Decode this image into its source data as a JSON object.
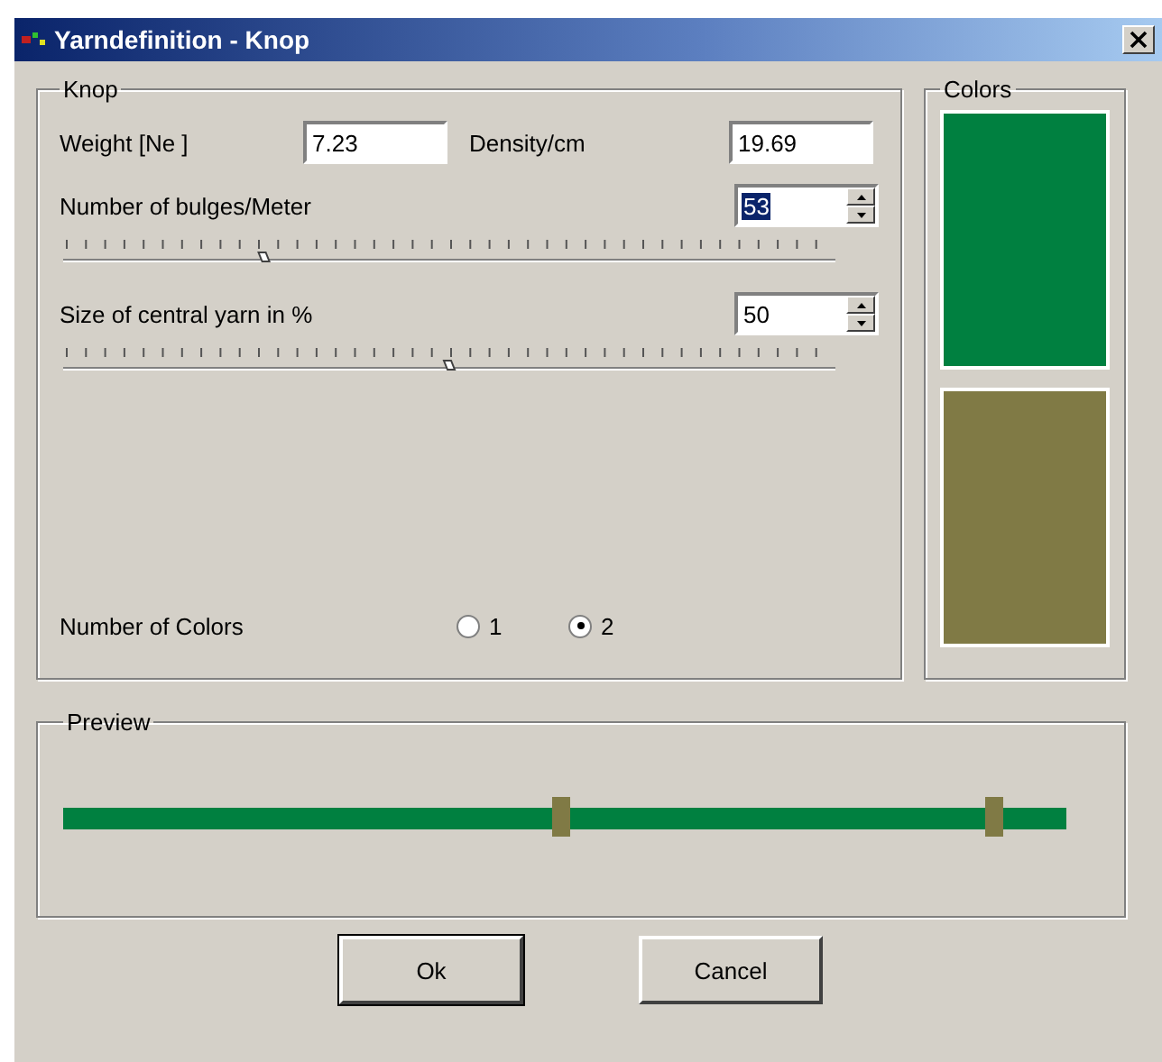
{
  "window": {
    "title": "Yarndefinition - Knop"
  },
  "knop": {
    "title": "Knop",
    "weight": {
      "label": "Weight [Ne ]",
      "value": "7.23"
    },
    "density": {
      "label": "Density/cm",
      "value": "19.69"
    },
    "bulges": {
      "label": "Number of bulges/Meter",
      "value": "53",
      "text_selected": true,
      "level": 0.26
    },
    "central": {
      "label": "Size of central yarn in %",
      "value": "50",
      "text_selected": false,
      "level": 0.5
    },
    "number_of_colors": {
      "label": "Number of Colors",
      "options": [
        {
          "label": "1",
          "selected": false
        },
        {
          "label": "2",
          "selected": true
        }
      ]
    }
  },
  "colors": {
    "title": "Colors",
    "swatches": [
      {
        "color": "#008040"
      },
      {
        "color": "#807a45"
      }
    ]
  },
  "preview": {
    "title": "Preview"
  },
  "buttons": [
    {
      "label": "Ok",
      "default": true
    },
    {
      "label": "Cancel",
      "default": false
    }
  ]
}
